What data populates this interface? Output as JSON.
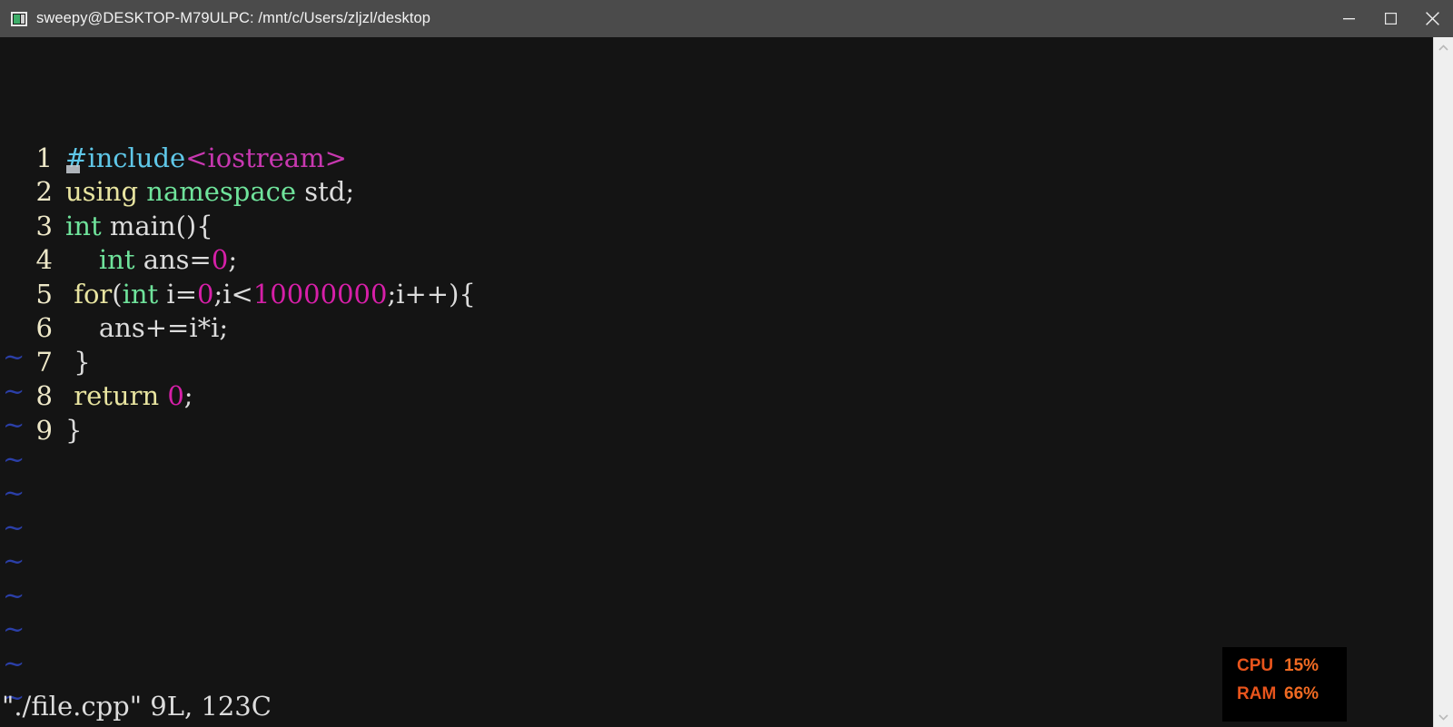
{
  "window": {
    "title": "sweepy@DESKTOP-M79ULPC: /mnt/c/Users/zljzl/desktop",
    "icon": "terminal-icon",
    "minimize_label": "Minimize",
    "maximize_label": "Maximize",
    "close_label": "Close"
  },
  "editor": {
    "background": "#141414",
    "linenumber_color": "#eee8c8",
    "tilde_color": "#2b3fa8",
    "lines": [
      {
        "n": "1",
        "tokens": [
          {
            "text": "#",
            "cls": "t-pp",
            "cursor": true
          },
          {
            "text": "include",
            "cls": "t-pp"
          },
          {
            "text": "<iostream>",
            "cls": "t-hdr"
          }
        ]
      },
      {
        "n": "2",
        "tokens": [
          {
            "text": "using ",
            "cls": "t-kw"
          },
          {
            "text": "namespace",
            "cls": "t-type"
          },
          {
            "text": " std;",
            "cls": "t-plain"
          }
        ]
      },
      {
        "n": "3",
        "tokens": [
          {
            "text": "int",
            "cls": "t-type"
          },
          {
            "text": " main(){",
            "cls": "t-plain"
          }
        ]
      },
      {
        "n": "4",
        "tokens": [
          {
            "text": "    ",
            "cls": "t-plain"
          },
          {
            "text": "int",
            "cls": "t-type"
          },
          {
            "text": " ans=",
            "cls": "t-plain"
          },
          {
            "text": "0",
            "cls": "t-num"
          },
          {
            "text": ";",
            "cls": "t-plain"
          }
        ]
      },
      {
        "n": "5",
        "tokens": [
          {
            "text": " ",
            "cls": "t-plain"
          },
          {
            "text": "for",
            "cls": "t-kw"
          },
          {
            "text": "(",
            "cls": "t-plain"
          },
          {
            "text": "int",
            "cls": "t-type"
          },
          {
            "text": " i=",
            "cls": "t-plain"
          },
          {
            "text": "0",
            "cls": "t-num"
          },
          {
            "text": ";i<",
            "cls": "t-plain"
          },
          {
            "text": "10000000",
            "cls": "t-num"
          },
          {
            "text": ";i++){",
            "cls": "t-plain"
          }
        ]
      },
      {
        "n": "6",
        "tokens": [
          {
            "text": "    ans+=i*i;",
            "cls": "t-plain"
          }
        ]
      },
      {
        "n": "7",
        "tokens": [
          {
            "text": " }",
            "cls": "t-plain"
          }
        ]
      },
      {
        "n": "8",
        "tokens": [
          {
            "text": " ",
            "cls": "t-plain"
          },
          {
            "text": "return",
            "cls": "t-kw"
          },
          {
            "text": " ",
            "cls": "t-plain"
          },
          {
            "text": "0",
            "cls": "t-num"
          },
          {
            "text": ";",
            "cls": "t-plain"
          }
        ]
      },
      {
        "n": "9",
        "tokens": [
          {
            "text": "}",
            "cls": "t-plain"
          }
        ]
      }
    ],
    "filler_rows": [
      "~",
      "~",
      "~",
      "~",
      "~",
      "~",
      "~",
      "~",
      "~",
      "~",
      "~"
    ],
    "status_line": "\"./file.cpp\" 9L, 123C"
  },
  "sysmon": {
    "accent": "#e8541c",
    "rows": [
      {
        "label": "CPU",
        "value": "15%"
      },
      {
        "label": "RAM",
        "value": "66%"
      }
    ]
  },
  "scrollbar": {
    "up_label": "Scroll up",
    "down_label": "Scroll down"
  }
}
